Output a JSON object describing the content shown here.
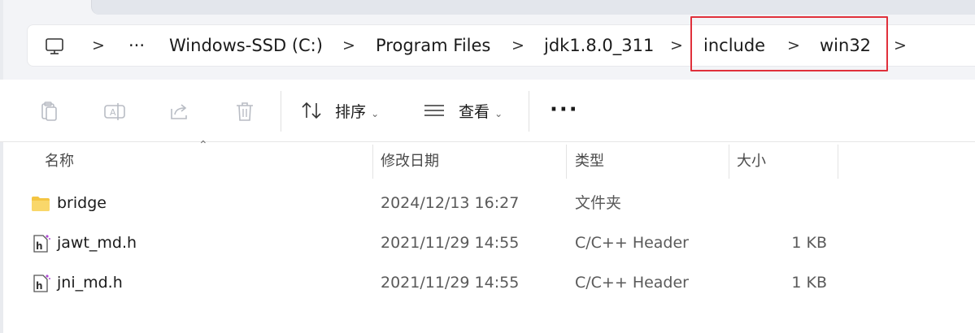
{
  "address_bar": {
    "ellipsis": "···",
    "crumbs": [
      "Windows-SSD (C:)",
      "Program Files",
      "jdk1.8.0_311",
      "include",
      "win32"
    ],
    "chevron": ">"
  },
  "toolbar": {
    "sort_label": "排序",
    "view_label": "查看",
    "more_label": "···"
  },
  "columns": {
    "name": "名称",
    "date": "修改日期",
    "type": "类型",
    "size": "大小"
  },
  "files": [
    {
      "name": "bridge",
      "date": "2024/12/13 16:27",
      "type": "文件夹",
      "size": "",
      "icon": "folder-icon"
    },
    {
      "name": "jawt_md.h",
      "date": "2021/11/29 14:55",
      "type": "C/C++ Header",
      "size": "1 KB",
      "icon": "header-file-icon"
    },
    {
      "name": "jni_md.h",
      "date": "2021/11/29 14:55",
      "type": "C/C++ Header",
      "size": "1 KB",
      "icon": "header-file-icon"
    }
  ],
  "colors": {
    "highlight": "#e0303b",
    "folder": "#f4c542"
  }
}
